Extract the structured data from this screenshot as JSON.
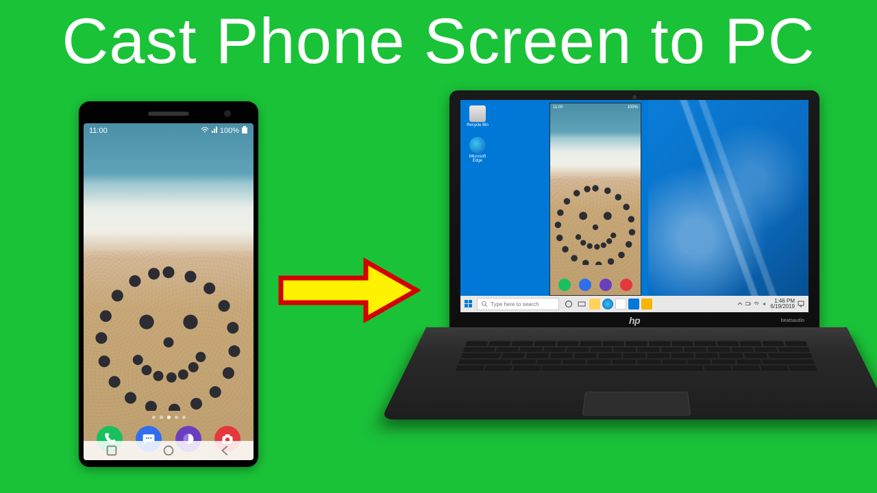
{
  "title": "Cast Phone Screen to PC",
  "phone": {
    "status": {
      "time": "11:00",
      "battery": "100%"
    },
    "dock": [
      {
        "color": "#18c15e",
        "name": "phone-icon",
        "glyph": "✆"
      },
      {
        "color": "#2f6fed",
        "name": "messages-icon",
        "glyph": "⋯"
      },
      {
        "color": "#6a3fbf",
        "name": "browser-icon",
        "glyph": "◐"
      },
      {
        "color": "#e5383b",
        "name": "camera-icon",
        "glyph": "◉"
      }
    ]
  },
  "laptop": {
    "brand": "hp",
    "audio_brand": "beatsaudio",
    "desktop_icons": [
      {
        "label": "Recycle Bin",
        "name": "recycle-bin-icon"
      },
      {
        "label": "Microsoft Edge",
        "name": "edge-icon"
      }
    ],
    "cast": {
      "status": {
        "time": "11:00",
        "battery": "100%"
      },
      "dock": [
        {
          "color": "#18c15e"
        },
        {
          "color": "#2f6fed"
        },
        {
          "color": "#6a3fbf"
        },
        {
          "color": "#e5383b"
        }
      ]
    },
    "taskbar": {
      "search_placeholder": "Type here to search",
      "clock_time": "1:46 PM",
      "clock_date": "6/19/2019"
    }
  }
}
